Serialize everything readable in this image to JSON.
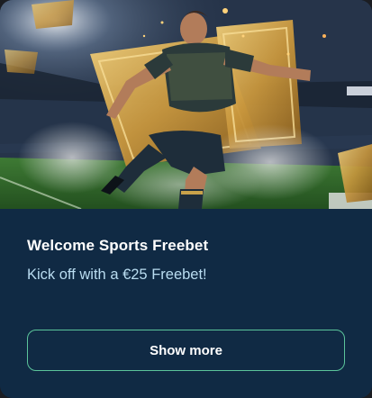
{
  "promo": {
    "image_label": "footballer-kicking-golden-ticket",
    "title": "Welcome Sports Freebet",
    "subtitle": "Kick off with a €25 Freebet!",
    "button_label": "Show more"
  },
  "colors": {
    "card_background": "#102a44",
    "title": "#ffffff",
    "subtitle": "#b9dcf0",
    "button_border": "#5bc49b"
  }
}
